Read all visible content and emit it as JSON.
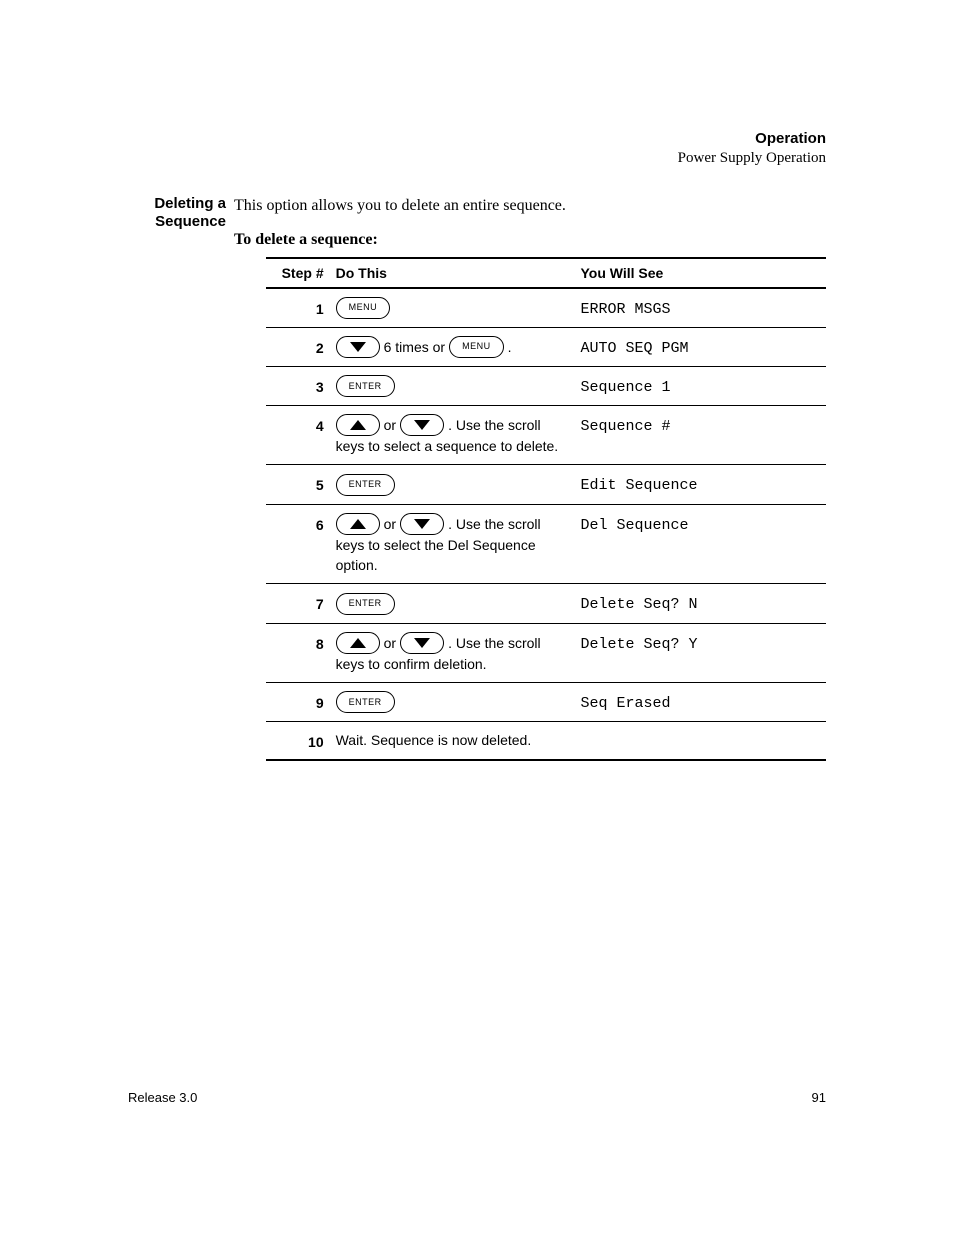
{
  "header": {
    "section": "Operation",
    "subsection": "Power Supply Operation"
  },
  "margin_title_line1": "Deleting a",
  "margin_title_line2": "Sequence",
  "intro": "This option allows you to delete an entire sequence.",
  "lead": "To delete a sequence:",
  "keys": {
    "menu": "MENU",
    "enter": "ENTER"
  },
  "table": {
    "columns": {
      "step": "Step #",
      "do": "Do This",
      "see": "You Will See"
    },
    "rows": [
      {
        "n": "1",
        "see": "ERROR MSGS"
      },
      {
        "n": "2",
        "text_after1": " 6 times or ",
        "text_after2": ".",
        "see": "AUTO SEQ PGM"
      },
      {
        "n": "3",
        "see": "Sequence 1"
      },
      {
        "n": "4",
        "mid": " or ",
        "after": ". Use the scroll",
        "line2": "keys to select a sequence to delete.",
        "see": "Sequence #"
      },
      {
        "n": "5",
        "see": "Edit Sequence"
      },
      {
        "n": "6",
        "mid": " or ",
        "after": ". Use the scroll",
        "line2": "keys to select the Del Sequence",
        "line3": "option.",
        "see": "Del Sequence"
      },
      {
        "n": "7",
        "see": "Delete Seq? N"
      },
      {
        "n": "8",
        "mid": " or ",
        "after": ". Use the scroll",
        "line2": "keys to confirm deletion.",
        "see": "Delete Seq? Y"
      },
      {
        "n": "9",
        "see": "Seq Erased"
      },
      {
        "n": "10",
        "text": "Wait. Sequence is now deleted.",
        "see": ""
      }
    ]
  },
  "footer": {
    "left": "Release 3.0",
    "right": "91"
  }
}
